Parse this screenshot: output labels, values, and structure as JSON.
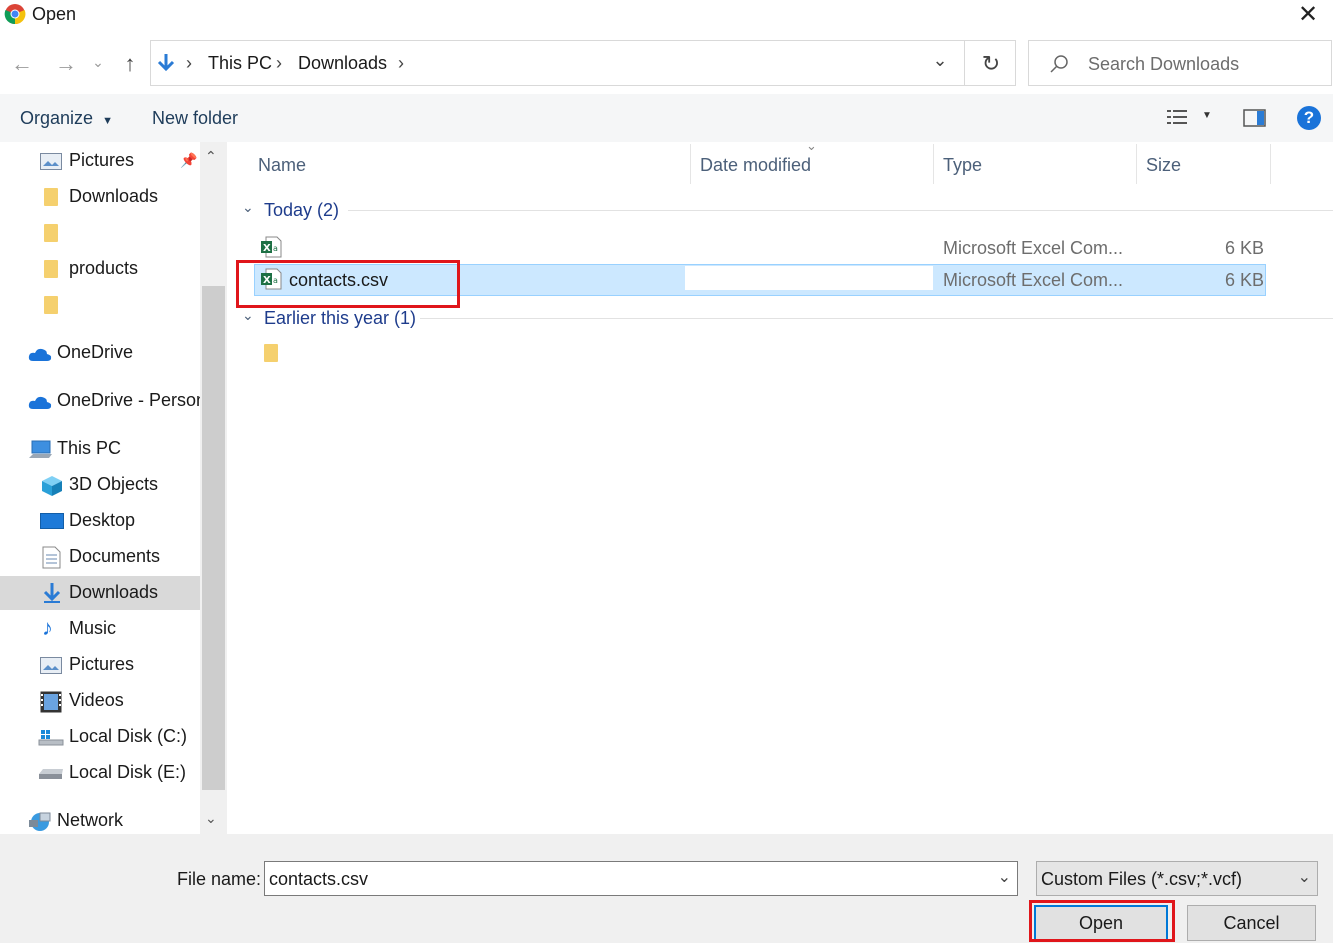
{
  "window": {
    "title": "Open",
    "close_glyph": "✕"
  },
  "nav_buttons": {
    "back": "←",
    "forward": "→",
    "history": "⌄",
    "up": "↑"
  },
  "address": {
    "breadcrumb": [
      "This PC",
      "Downloads"
    ],
    "sep": "›",
    "dropdown_glyph": "⌄",
    "refresh_glyph": "↻"
  },
  "search": {
    "placeholder": "Search Downloads"
  },
  "toolbar": {
    "organize": "Organize",
    "new_folder": "New folder",
    "help": "?"
  },
  "sidebar": {
    "items": [
      {
        "label": "Pictures",
        "icon": "pictures-icon"
      },
      {
        "label": "Downloads",
        "icon": "folder-icon"
      },
      {
        "label": "",
        "icon": "folder-icon"
      },
      {
        "label": "products",
        "icon": "folder-icon"
      },
      {
        "label": "",
        "icon": "folder-icon"
      },
      {
        "label": "OneDrive",
        "icon": "onedrive-icon"
      },
      {
        "label": "OneDrive - Person",
        "icon": "onedrive-icon"
      },
      {
        "label": "This PC",
        "icon": "this-pc-icon"
      },
      {
        "label": "3D Objects",
        "icon": "3d-objects-icon"
      },
      {
        "label": "Desktop",
        "icon": "desktop-icon"
      },
      {
        "label": "Documents",
        "icon": "documents-icon"
      },
      {
        "label": "Downloads",
        "icon": "downloads-icon"
      },
      {
        "label": "Music",
        "icon": "music-icon"
      },
      {
        "label": "Pictures",
        "icon": "pictures-icon"
      },
      {
        "label": "Videos",
        "icon": "videos-icon"
      },
      {
        "label": "Local Disk (C:)",
        "icon": "local-disk-icon"
      },
      {
        "label": "Local Disk (E:)",
        "icon": "local-disk-icon"
      },
      {
        "label": "Network",
        "icon": "network-icon"
      }
    ]
  },
  "columns": {
    "name": "Name",
    "date": "Date modified",
    "type": "Type",
    "size": "Size"
  },
  "groups": {
    "today": "Today (2)",
    "earlier": "Earlier this year (1)"
  },
  "files": [
    {
      "name": "",
      "type": "Microsoft Excel Com...",
      "size": "6 KB"
    },
    {
      "name": "contacts.csv",
      "type": "Microsoft Excel Com...",
      "size": "6 KB"
    }
  ],
  "bottom": {
    "file_name_label": "File name:",
    "file_name_value": "contacts.csv",
    "file_type_value": "Custom Files (*.csv;*.vcf)",
    "open": "Open",
    "cancel": "Cancel"
  },
  "colors": {
    "accent": "#0078d7",
    "highlight": "#e0161b",
    "selection": "#cce8ff"
  }
}
